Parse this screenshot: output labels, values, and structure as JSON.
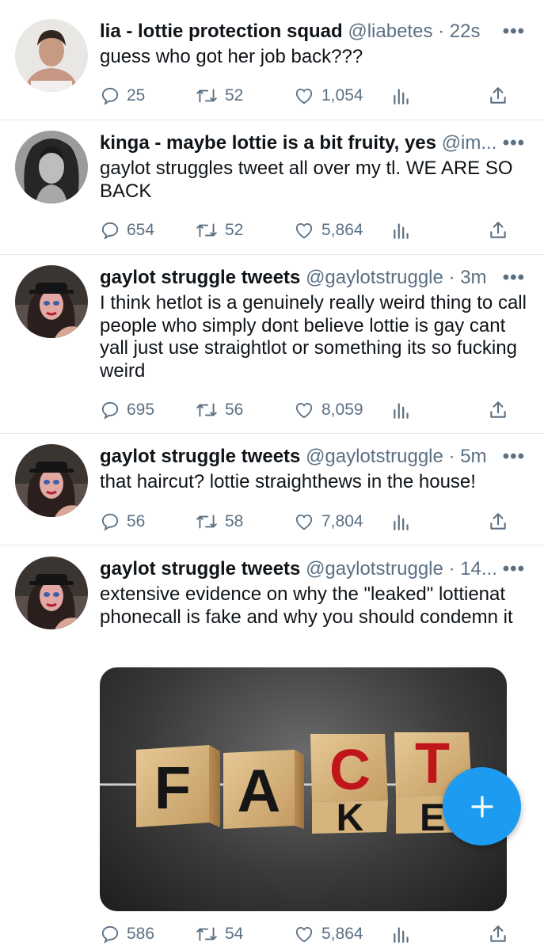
{
  "tweets": [
    {
      "name": "lia - lottie protection squad",
      "handle": "@liabetes",
      "time": "22s",
      "text": "guess who got her job back???",
      "replies": "25",
      "retweets": "52",
      "likes": "1,054"
    },
    {
      "name": "kinga - maybe lottie is a bit fruity, yes",
      "handle": "@im...",
      "time": "",
      "text": "gaylot struggles tweet all over my tl. WE ARE SO BACK",
      "replies": "654",
      "retweets": "52",
      "likes": "5,864"
    },
    {
      "name": "gaylot struggle tweets",
      "handle": "@gaylotstruggle",
      "time": "3m",
      "text": "I think hetlot is a genuinely really weird thing to call people who simply dont believe lottie is gay cant yall just use straightlot or something its so fucking weird",
      "replies": "695",
      "retweets": "56",
      "likes": "8,059"
    },
    {
      "name": "gaylot struggle tweets",
      "handle": "@gaylotstruggle",
      "time": "5m",
      "text": "that haircut? lottie straighthews in the house!",
      "replies": "56",
      "retweets": "58",
      "likes": "7,804"
    },
    {
      "name": "gaylot struggle tweets",
      "handle": "@gaylotstruggle",
      "time": "14...",
      "text": "extensive evidence on why the \"leaked\" lottienat phonecall is fake and why you should condemn it",
      "replies": "586",
      "retweets": "54",
      "likes": "5,864",
      "media": {
        "top_row": [
          "F",
          "A",
          "C",
          "T"
        ],
        "bottom_row": [
          "K",
          "E"
        ]
      }
    }
  ],
  "icons": {
    "reply": "speech-bubble-icon",
    "retweet": "retweet-icon",
    "like": "heart-icon",
    "analytics": "bar-chart-icon",
    "share": "share-icon",
    "more": "ellipsis-icon",
    "compose": "plus-icon"
  },
  "colors": {
    "accent": "#1d9bf0",
    "secondary_text": "#5b7083",
    "text": "#0f1419",
    "letter_red": "#c0161b"
  }
}
